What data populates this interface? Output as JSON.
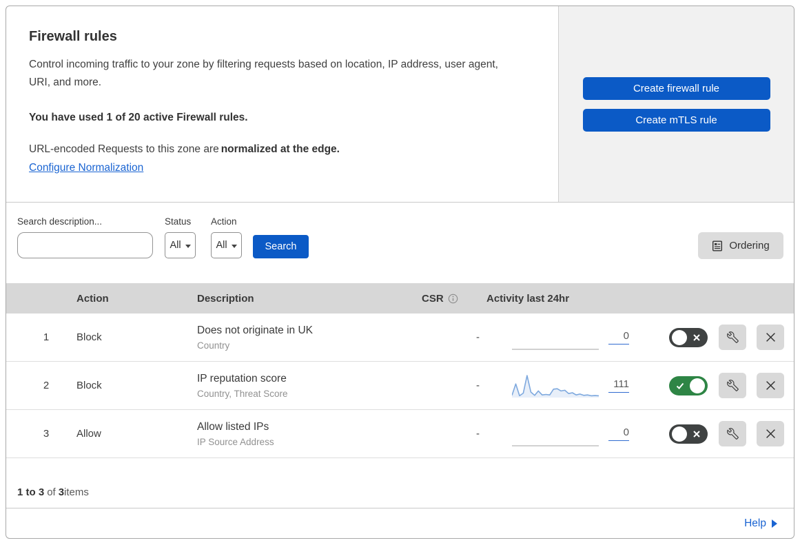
{
  "header": {
    "title": "Firewall rules",
    "description": "Control incoming traffic to your zone by filtering requests based on location, IP address, user agent, URI, and more.",
    "usage_note": "You have used 1 of 20 active Firewall rules.",
    "normalization_text": "URL-encoded Requests to this zone are",
    "normalization_bold": "normalized at the edge.",
    "normalization_link": "Configure Normalization",
    "create_firewall_button": "Create firewall rule",
    "create_mtls_button": "Create mTLS rule"
  },
  "filters": {
    "search_label": "Search description...",
    "search_value": "",
    "status_label": "Status",
    "status_value": "All",
    "action_label": "Action",
    "action_value": "All",
    "search_button": "Search",
    "ordering_button": "Ordering"
  },
  "table": {
    "headers": {
      "action": "Action",
      "description": "Description",
      "csr": "CSR",
      "activity": "Activity last 24hr"
    },
    "rows": [
      {
        "index": "1",
        "action": "Block",
        "description": "Does not originate in UK",
        "criteria": "Country",
        "csr": "-",
        "activity_count": "0",
        "enabled": false,
        "sparkline": [
          0,
          0,
          0,
          0,
          0,
          0,
          0,
          0,
          0,
          0,
          0,
          0,
          0,
          0,
          0,
          0,
          0,
          0,
          0,
          0,
          0,
          0,
          0,
          0
        ]
      },
      {
        "index": "2",
        "action": "Block",
        "description": "IP reputation score",
        "criteria": "Country, Threat Score",
        "csr": "-",
        "activity_count": "111",
        "enabled": true,
        "sparkline": [
          10,
          62,
          8,
          20,
          100,
          25,
          10,
          30,
          12,
          14,
          12,
          38,
          40,
          30,
          33,
          18,
          22,
          12,
          16,
          10,
          12,
          8,
          9,
          8
        ]
      },
      {
        "index": "3",
        "action": "Allow",
        "description": "Allow listed IPs",
        "criteria": "IP Source Address",
        "csr": "-",
        "activity_count": "0",
        "enabled": false,
        "sparkline": [
          0,
          0,
          0,
          0,
          0,
          0,
          0,
          0,
          0,
          0,
          0,
          0,
          0,
          0,
          0,
          0,
          0,
          0,
          0,
          0,
          0,
          0,
          0,
          0
        ]
      }
    ]
  },
  "pagination": {
    "range": "1 to 3",
    "of": "of",
    "total": "3",
    "items": "items"
  },
  "help": {
    "label": "Help"
  },
  "icons": {
    "search": "magnifier",
    "ordering": "list-document",
    "csr_info": "info-circle",
    "wrench": "wrench",
    "delete": "x-cross",
    "toggle_on": "checkmark",
    "toggle_off": "x-cross",
    "help": "right-triangle"
  },
  "colors": {
    "primary_button": "#0b5ac6",
    "link": "#1a64d2",
    "toggle_on": "#2e8545",
    "toggle_off": "#3f4242",
    "sparkline_line": "#7da8de",
    "header_panel_bg": "#f1f1f1",
    "table_header_bg": "#d7d7d7"
  }
}
